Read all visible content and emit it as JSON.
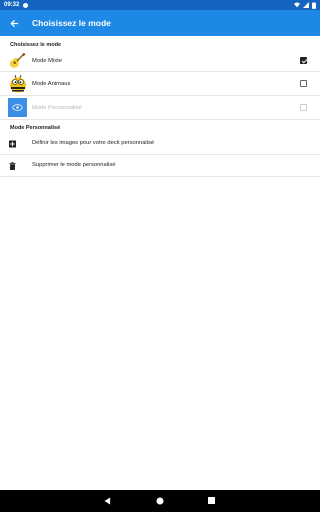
{
  "status": {
    "time": "09:32"
  },
  "appbar": {
    "title": "Choisissez le mode"
  },
  "section1": {
    "heading": "Choisissez le mode",
    "modes": [
      {
        "label": "Mode Mixte",
        "checked": true,
        "disabled": false,
        "icon": "guitar-icon"
      },
      {
        "label": "Mode Animaux",
        "checked": false,
        "disabled": false,
        "icon": "bee-icon"
      },
      {
        "label": "Mode Personnalisé",
        "checked": false,
        "disabled": true,
        "icon": "custom-eye-icon"
      }
    ]
  },
  "section2": {
    "heading": "Mode Personnalisé",
    "actions": [
      {
        "label": "Définir les images pour votre deck personnalisé",
        "icon": "add-image-icon"
      },
      {
        "label": "Supprimer le mode personnalisé",
        "icon": "trash-icon"
      }
    ]
  },
  "colors": {
    "appbar": "#1e88e5",
    "statusbar": "#1565c0"
  }
}
